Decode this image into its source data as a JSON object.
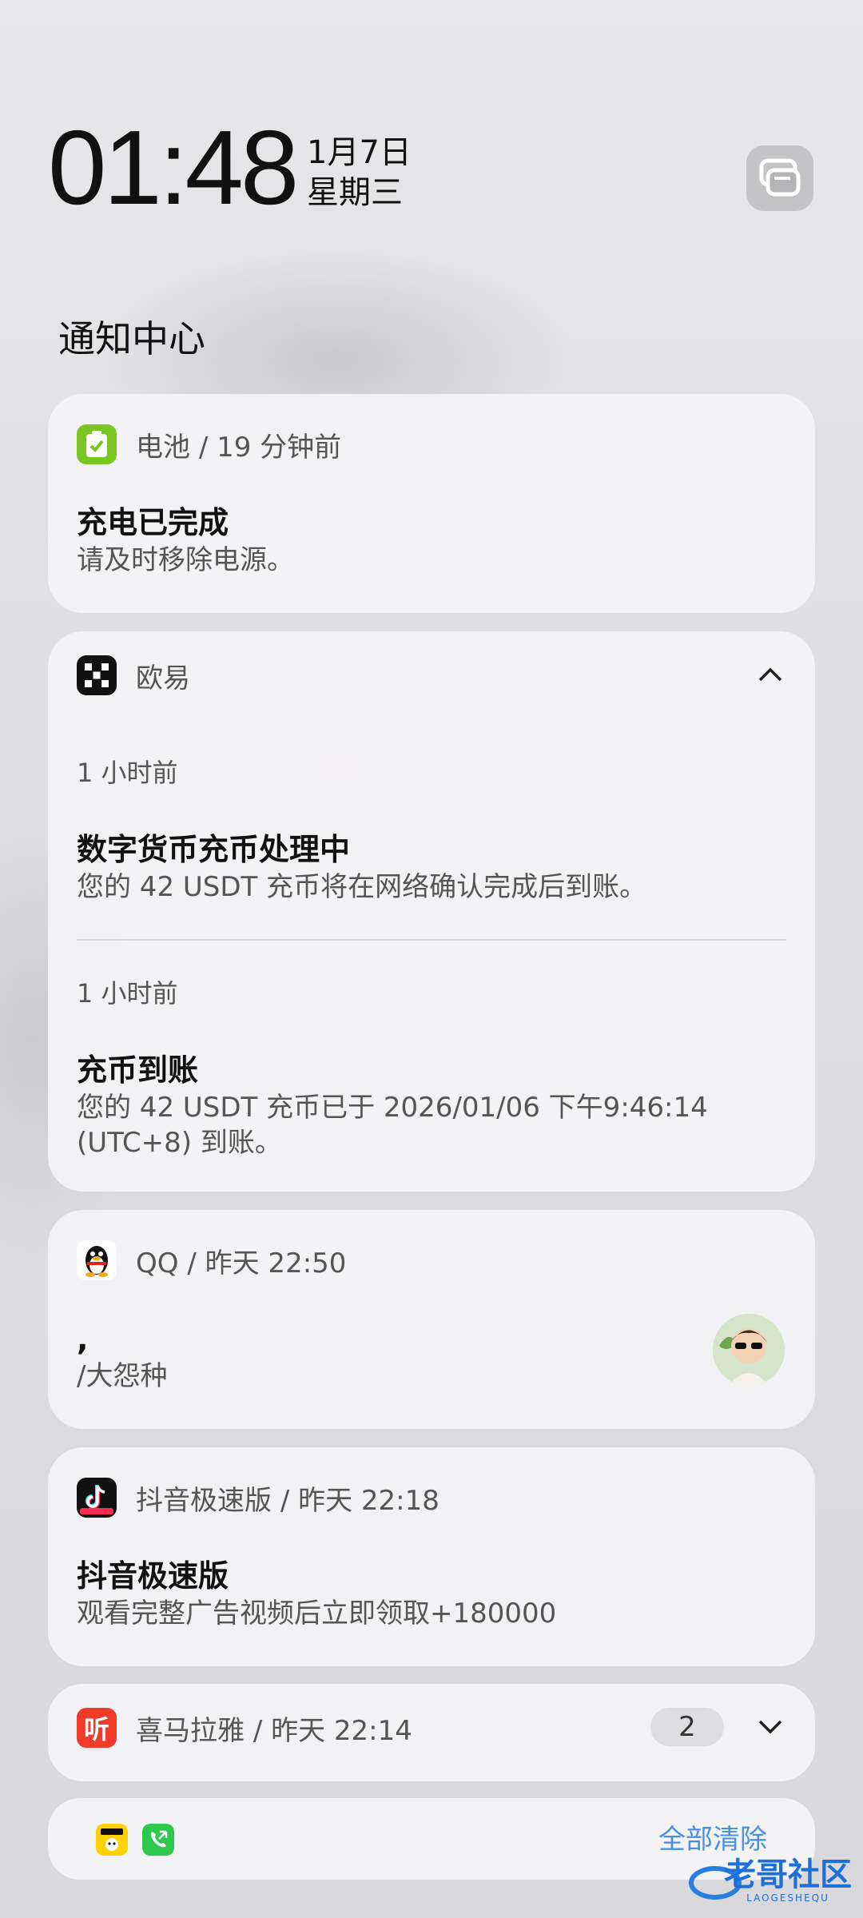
{
  "lockscreen": {
    "time": "01:48",
    "date": "1月7日",
    "weekday": "星期三"
  },
  "section_title": "通知中心",
  "battery": {
    "app": "电池",
    "sep": "/",
    "ago": "19 分钟前",
    "title": "充电已完成",
    "body": "请及时移除电源。",
    "icon": "battery-check-icon",
    "color": "#7ac520"
  },
  "okx": {
    "app": "欧易",
    "icon": "okx-logo-icon",
    "messages": [
      {
        "time": "1 小时前",
        "title": "数字货币充币处理中",
        "body": "您的 42 USDT 充币将在网络确认完成后到账。"
      },
      {
        "time": "1 小时前",
        "title": "充币到账",
        "body": "您的 42 USDT 充币已于 2026/01/06 下午9:46:14 (UTC+8) 到账。"
      }
    ]
  },
  "qq": {
    "app": "QQ",
    "sep": "/",
    "ago": "昨天 22:50",
    "title": ",",
    "body": "/大怨种",
    "icon": "qq-penguin-icon"
  },
  "douyin": {
    "app": "抖音极速版",
    "sep": "/",
    "ago": "昨天 22:18",
    "title": "抖音极速版",
    "body": "观看完整广告视频后立即领取+180000",
    "icon": "douyin-icon"
  },
  "ximalaya": {
    "app": "喜马拉雅",
    "sep": "/",
    "ago": "昨天 22:14",
    "count": "2",
    "icon": "ximalaya-icon",
    "icon_text": "听",
    "color": "#f03a2a"
  },
  "bottom": {
    "clear_all": "全部清除",
    "icons": [
      "meituan-icon",
      "phone-call-icon"
    ]
  },
  "watermark": {
    "text": "老哥社区",
    "sub": "LAOGESHEQU"
  }
}
